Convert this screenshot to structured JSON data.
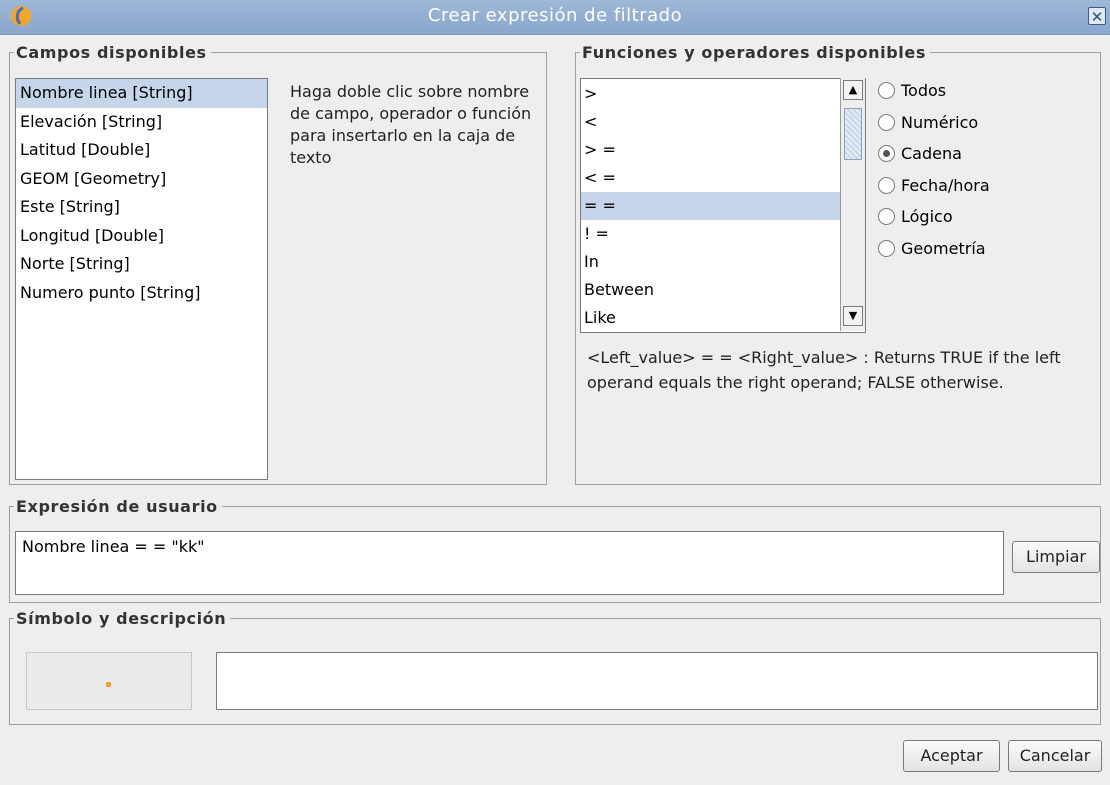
{
  "window": {
    "title": "Crear expresión de filtrado",
    "close_icon": "close-icon"
  },
  "fields_panel": {
    "legend": "Campos disponibles",
    "items": [
      {
        "label": "Nombre linea [String]",
        "selected": true
      },
      {
        "label": "Elevación [String]",
        "selected": false
      },
      {
        "label": "Latitud [Double]",
        "selected": false
      },
      {
        "label": "GEOM [Geometry]",
        "selected": false
      },
      {
        "label": "Este [String]",
        "selected": false
      },
      {
        "label": "Longitud [Double]",
        "selected": false
      },
      {
        "label": "Norte [String]",
        "selected": false
      },
      {
        "label": "Numero punto [String]",
        "selected": false
      }
    ],
    "hint": "Haga doble clic sobre nombre de campo, operador o función para insertarlo en la caja de texto"
  },
  "functions_panel": {
    "legend": "Funciones y operadores disponibles",
    "operators": [
      {
        "label": ">",
        "selected": false
      },
      {
        "label": "<",
        "selected": false
      },
      {
        "label": "> =",
        "selected": false
      },
      {
        "label": "< =",
        "selected": false
      },
      {
        "label": "= =",
        "selected": true
      },
      {
        "label": "! =",
        "selected": false
      },
      {
        "label": "In",
        "selected": false
      },
      {
        "label": "Between",
        "selected": false
      },
      {
        "label": "Like",
        "selected": false
      }
    ],
    "filters": [
      {
        "label": "Todos",
        "checked": false
      },
      {
        "label": "Numérico",
        "checked": false
      },
      {
        "label": "Cadena",
        "checked": true
      },
      {
        "label": "Fecha/hora",
        "checked": false
      },
      {
        "label": "Lógico",
        "checked": false
      },
      {
        "label": "Geometría",
        "checked": false
      }
    ],
    "description": "<Left_value> = = <Right_value> : Returns TRUE if the left operand equals the right operand; FALSE otherwise."
  },
  "expression_panel": {
    "legend": "Expresión de usuario",
    "value": "Nombre linea = = \"kk\"",
    "clear_label": "Limpiar"
  },
  "symbol_panel": {
    "legend": "Símbolo y descripción",
    "description_value": ""
  },
  "footer": {
    "accept_label": "Aceptar",
    "cancel_label": "Cancelar"
  },
  "colors": {
    "titlebar": "#8aa6cc",
    "selection": "#c6d5ea",
    "symbol_point": "#f0a030"
  }
}
